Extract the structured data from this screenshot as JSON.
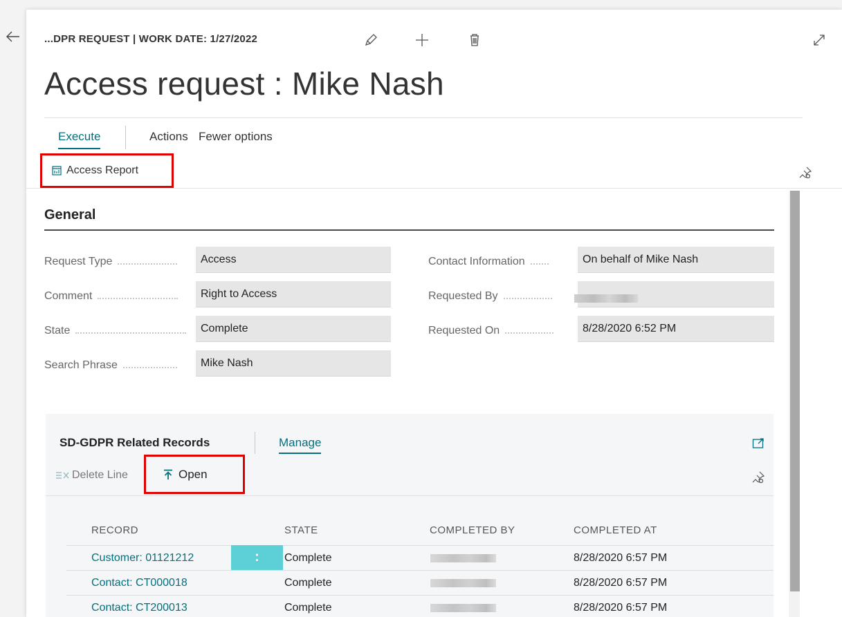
{
  "header": {
    "breadcrumb": "...DPR REQUEST | WORK DATE: 1/27/2022",
    "title": "Access request : Mike Nash"
  },
  "icons": [
    "back-arrow-icon",
    "edit-pencil-icon",
    "add-plus-icon",
    "delete-trash-icon",
    "expand-icon",
    "pin-icon",
    "report-icon",
    "delete-line-icon",
    "open-icon",
    "fullscreen-icon"
  ],
  "action_tabs": {
    "execute": "Execute",
    "actions": "Actions",
    "fewer_options": "Fewer options"
  },
  "action_bar": {
    "access_report": "Access Report"
  },
  "general": {
    "title": "General",
    "fields": {
      "request_type": {
        "label": "Request Type",
        "value": "Access"
      },
      "comment": {
        "label": "Comment",
        "value": "Right to Access"
      },
      "state": {
        "label": "State",
        "value": "Complete"
      },
      "search_phrase": {
        "label": "Search Phrase",
        "value": "Mike Nash"
      },
      "contact_information": {
        "label": "Contact Information",
        "value": "On behalf of Mike Nash"
      },
      "requested_by": {
        "label": "Requested By",
        "value": ""
      },
      "requested_on": {
        "label": "Requested On",
        "value": "8/28/2020 6:52 PM"
      }
    }
  },
  "related_records": {
    "title": "SD-GDPR Related Records",
    "manage": "Manage",
    "delete_line": "Delete Line",
    "open": "Open",
    "row_menu": ":",
    "columns": {
      "record": "RECORD",
      "state": "STATE",
      "completed_by": "COMPLETED BY",
      "completed_at": "COMPLETED AT"
    },
    "rows": [
      {
        "record": "Customer: 01121212",
        "state": "Complete",
        "completed_by": "",
        "completed_at": "8/28/2020 6:57 PM"
      },
      {
        "record": "Contact: CT000018",
        "state": "Complete",
        "completed_by": "",
        "completed_at": "8/28/2020 6:57 PM"
      },
      {
        "record": "Contact: CT200013",
        "state": "Complete",
        "completed_by": "",
        "completed_at": "8/28/2020 6:57 PM"
      }
    ]
  },
  "colors": {
    "accent": "#00707f",
    "highlight_box": "#e00000",
    "row_menu_bg": "#5dcfd6"
  }
}
